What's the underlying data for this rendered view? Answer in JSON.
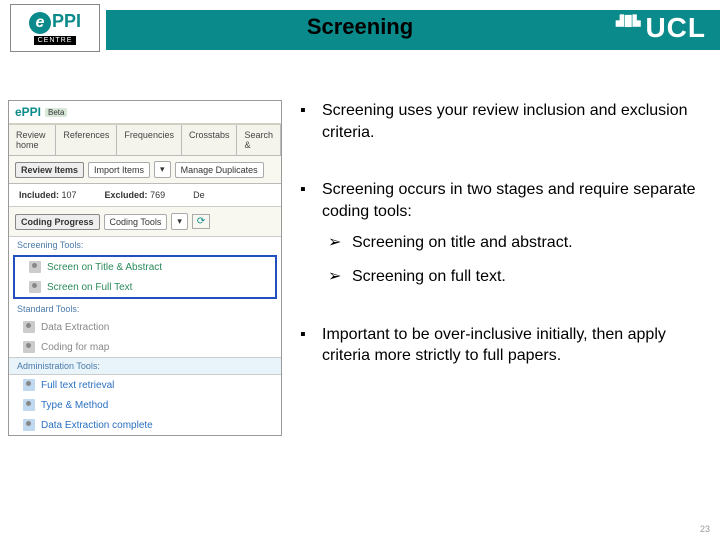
{
  "header": {
    "title": "Screening",
    "logo_text": "PPI",
    "logo_centre": "CENTRE",
    "ucl": "UCL"
  },
  "bullets": {
    "b1": "Screening uses your review inclusion and exclusion criteria.",
    "b2": "Screening occurs in two stages and require separate coding tools:",
    "s1": "Screening on title and abstract.",
    "s2": "Screening on full text.",
    "b3": "Important to be over-inclusive initially, then apply criteria more strictly to full papers."
  },
  "ss": {
    "logo": "ePPI",
    "beta": "Beta",
    "tabs": [
      "Review home",
      "References",
      "Frequencies",
      "Crosstabs",
      "Search &"
    ],
    "bar": {
      "review_items": "Review Items",
      "import": "Import Items",
      "manage_dup": "Manage Duplicates",
      "caret": "▾"
    },
    "counts": {
      "inc_label": "Included:",
      "inc": "107",
      "exc_label": "Excluded:",
      "exc": "769",
      "del_label": "De"
    },
    "coding_hdr": "Coding Progress",
    "coding_tools_btn": "Coding Tools",
    "refresh": "⟳",
    "grp1": "Screening Tools:",
    "t1": "Screen on Title & Abstract",
    "t2": "Screen on Full Text",
    "grp2": "Standard Tools:",
    "t3": "Data Extraction",
    "t4": "Coding for map",
    "grp3": "Administration Tools:",
    "t5": "Full text retrieval",
    "t6": "Type & Method",
    "t7": "Data Extraction complete"
  },
  "page": "23"
}
